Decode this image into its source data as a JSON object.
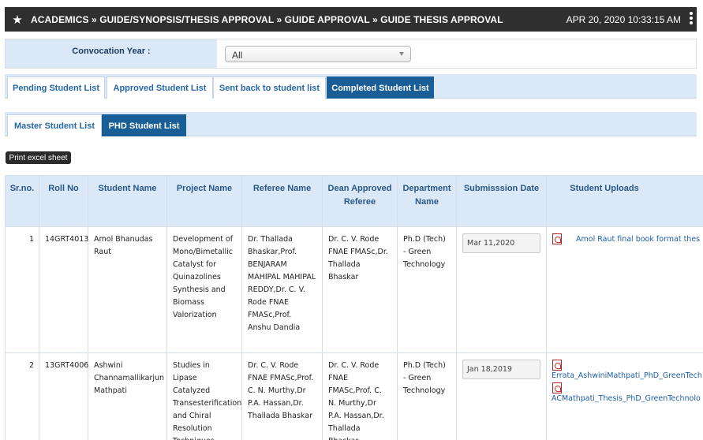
{
  "header": {
    "breadcrumb": "ACADEMICS » GUIDE/SYNOPSIS/THESIS APPROVAL » GUIDE APPROVAL » GUIDE THESIS APPROVAL",
    "datetime": "APR 20, 2020   10:33:15 AM"
  },
  "filter": {
    "label": "Convocation Year :",
    "selected": "All"
  },
  "tabs_primary": [
    "Pending Student List",
    "Approved Student List",
    "Sent back to student list",
    "Completed Student List"
  ],
  "tabs_primary_active": "Completed Student List",
  "tabs_secondary": [
    "Master Student List",
    "PHD Student List"
  ],
  "tabs_secondary_active": "PHD Student List",
  "print_button": "Print excel sheet",
  "table": {
    "headers": [
      "Sr.no.",
      "Roll No",
      "Student Name",
      "Project Name",
      "Referee Name",
      "Dean Approved Referee",
      "Department Name",
      "Submisssion Date",
      "Student Uploads"
    ],
    "rows": [
      {
        "srno": "1",
        "roll": "14GRT4013",
        "name": "Amol Bhanudas Raut",
        "project": "Development of Mono/Bimetallic Catalyst for Quinazolines Synthesis and Biomass Valorization",
        "referee": "Dr. Thallada Bhaskar,Prof. BENJARAM MAHIPAL MAHIPAL REDDY,Dr. C. V. Rode FNAE FMASc,Prof. Anshu Dandia",
        "dean_referee": "Dr. C. V. Rode FNAE FMASc,Dr. Thallada Bhaskar",
        "department": "Ph.D (Tech) - Green Technology",
        "date": "Mar 11,2020",
        "uploads": [
          "Amol Raut final book format thes"
        ]
      },
      {
        "srno": "2",
        "roll": "13GRT4006",
        "name": "Ashwini Channamallikarjun Mathpati",
        "project": "Studies in Lipase Catalyzed Transesterification and Chiral Resolution Techniques",
        "referee": "Dr. C. V. Rode FNAE FMASc,Prof. C. N. Murthy,Dr P.A. Hassan,Dr. Thallada Bhaskar",
        "dean_referee": "Dr. C. V. Rode FNAE FMASc,Prof. C. N. Murthy,Dr P.A. Hassan,Dr. Thallada Bhaskar",
        "department": "Ph.D (Tech) - Green Technology",
        "date": "Jan 18,2019",
        "uploads": [
          "Errata_AshwiniMathpati_PhD_GreenTech",
          "ACMathpati_Thesis_PhD_GreenTechnolo"
        ]
      }
    ]
  },
  "colors": {
    "header_bg": "#2f2f2f",
    "tab_active_bg": "#1a5e98",
    "tab_bar_bg": "#dbe8f8",
    "link": "#1e5fa8"
  },
  "icons": [
    "star-icon",
    "kebab-menu-icon",
    "dropdown-arrow-icon",
    "pdf-icon"
  ]
}
